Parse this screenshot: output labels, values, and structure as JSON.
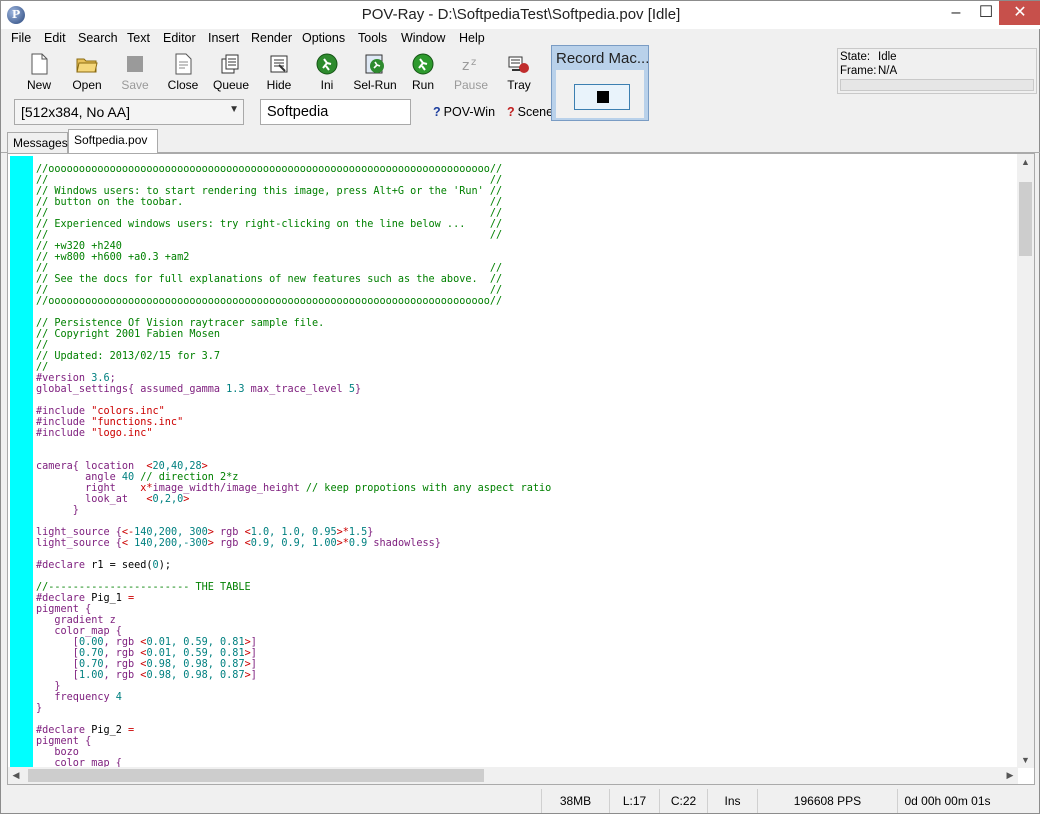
{
  "window": {
    "title": "POV-Ray - D:\\SoftpediaTest\\Softpedia.pov [Idle]",
    "controls": {
      "minimize": "–",
      "maximize": "☐",
      "close": "✕"
    }
  },
  "menu": [
    "File",
    "Edit",
    "Search",
    "Text",
    "Editor",
    "Insert",
    "Render",
    "Options",
    "Tools",
    "Window",
    "Help"
  ],
  "toolbar": [
    {
      "label": "New",
      "icon": "new-document-icon",
      "enabled": true
    },
    {
      "label": "Open",
      "icon": "open-folder-icon",
      "enabled": true
    },
    {
      "label": "Save",
      "icon": "save-icon",
      "enabled": false
    },
    {
      "label": "Close",
      "icon": "close-document-icon",
      "enabled": true
    },
    {
      "label": "Queue",
      "icon": "queue-icon",
      "enabled": true
    },
    {
      "label": "Hide",
      "icon": "hide-icon",
      "enabled": true
    },
    {
      "label": "Ini",
      "icon": "ini-runner-icon",
      "enabled": true
    },
    {
      "label": "Sel-Run",
      "icon": "sel-run-icon",
      "enabled": true
    },
    {
      "label": "Run",
      "icon": "run-icon",
      "enabled": true
    },
    {
      "label": "Pause",
      "icon": "pause-icon",
      "enabled": false
    },
    {
      "label": "Tray",
      "icon": "tray-icon",
      "enabled": true
    }
  ],
  "status_box": {
    "state_label": "State:",
    "state_value": "Idle",
    "frame_label": "Frame:",
    "frame_value": "N/A"
  },
  "resolution": {
    "selected": "[512x384, No AA]"
  },
  "scene_name": "Softpedia",
  "help_links": {
    "pov_win": "POV-Win",
    "scene": "Scene"
  },
  "tabs": [
    "Messages",
    "Softpedia.pov"
  ],
  "record_macro": {
    "title": "Record Mac..."
  },
  "editor_lines": [
    [
      [
        "cm",
        "//oooooooooooooooooooooooooooooooooooooooooooooooooooooooooooooooooooooooo//"
      ]
    ],
    [
      [
        "cm",
        "//                                                                        //"
      ]
    ],
    [
      [
        "cm",
        "// Windows users: to start rendering this image, press Alt+G or the 'Run' //"
      ]
    ],
    [
      [
        "cm",
        "// button on the toobar.                                                  //"
      ]
    ],
    [
      [
        "cm",
        "//                                                                        //"
      ]
    ],
    [
      [
        "cm",
        "// Experienced windows users: try right-clicking on the line below ...    //"
      ]
    ],
    [
      [
        "cm",
        "//                                                                        //"
      ]
    ],
    [
      [
        "cm",
        "// +w320 +h240"
      ]
    ],
    [
      [
        "cm",
        "// +w800 +h600 +a0.3 +am2"
      ]
    ],
    [
      [
        "cm",
        "//                                                                        //"
      ]
    ],
    [
      [
        "cm",
        "// See the docs for full explanations of new features such as the above.  //"
      ]
    ],
    [
      [
        "cm",
        "//                                                                        //"
      ]
    ],
    [
      [
        "cm",
        "//oooooooooooooooooooooooooooooooooooooooooooooooooooooooooooooooooooooooo//"
      ]
    ],
    [],
    [
      [
        "cm",
        "// Persistence Of Vision raytracer sample file."
      ]
    ],
    [
      [
        "cm",
        "// Copyright 2001 Fabien Mosen"
      ]
    ],
    [
      [
        "cm",
        "//"
      ]
    ],
    [
      [
        "cm",
        "// Updated: 2013/02/15 for 3.7"
      ]
    ],
    [
      [
        "cm",
        "//"
      ]
    ],
    [
      [
        "kw",
        "#version "
      ],
      [
        "nm",
        "3.6"
      ],
      [
        "kw",
        ";"
      ]
    ],
    [
      [
        "kw",
        "global_settings{ assumed_gamma "
      ],
      [
        "nm",
        "1.3"
      ],
      [
        "kw",
        " max_trace_level "
      ],
      [
        "nm",
        "5"
      ],
      [
        "kw",
        "}"
      ]
    ],
    [],
    [
      [
        "kw",
        "#include "
      ],
      [
        "st",
        "\"colors.inc\""
      ]
    ],
    [
      [
        "kw",
        "#include "
      ],
      [
        "st",
        "\"functions.inc\""
      ]
    ],
    [
      [
        "kw",
        "#include "
      ],
      [
        "st",
        "\"logo.inc\""
      ]
    ],
    [],
    [],
    [
      [
        "kw",
        "camera{ location  "
      ],
      [
        "st",
        "<"
      ],
      [
        "nm",
        "20,40,28"
      ],
      [
        "st",
        ">"
      ]
    ],
    [
      [
        "kw",
        "        angle "
      ],
      [
        "nm",
        "40"
      ],
      [
        "cm",
        " // direction 2*z"
      ]
    ],
    [
      [
        "kw",
        "        right    "
      ],
      [
        "st",
        "x*"
      ],
      [
        "kw",
        "image_width/image_height "
      ],
      [
        "cm",
        "// keep propotions with any aspect ratio"
      ]
    ],
    [
      [
        "kw",
        "        look_at   "
      ],
      [
        "st",
        "<"
      ],
      [
        "nm",
        "0,2,0"
      ],
      [
        "st",
        ">"
      ]
    ],
    [
      [
        "kw",
        "      }"
      ]
    ],
    [],
    [
      [
        "kw",
        "light_source {"
      ],
      [
        "st",
        "<-"
      ],
      [
        "nm",
        "140,200, 300"
      ],
      [
        "st",
        ">"
      ],
      [
        "kw",
        " rgb "
      ],
      [
        "st",
        "<"
      ],
      [
        "nm",
        "1.0, 1.0, 0.95"
      ],
      [
        "st",
        ">*"
      ],
      [
        "nm",
        "1.5"
      ],
      [
        "kw",
        "}"
      ]
    ],
    [
      [
        "kw",
        "light_source {"
      ],
      [
        "st",
        "< "
      ],
      [
        "nm",
        "140,200,-300"
      ],
      [
        "st",
        ">"
      ],
      [
        "kw",
        " rgb "
      ],
      [
        "st",
        "<"
      ],
      [
        "nm",
        "0.9, 0.9, 1.00"
      ],
      [
        "st",
        ">*"
      ],
      [
        "nm",
        "0.9"
      ],
      [
        "kw",
        " shadowless}"
      ]
    ],
    [],
    [
      [
        "kw",
        "#declare "
      ],
      [
        "plain",
        "r1 = seed("
      ],
      [
        "nm",
        "0"
      ],
      [
        "plain",
        ");"
      ]
    ],
    [],
    [
      [
        "cm",
        "//----------------------- THE TABLE"
      ]
    ],
    [
      [
        "kw",
        "#declare "
      ],
      [
        "plain",
        "Pig_1 "
      ],
      [
        "st",
        "="
      ]
    ],
    [
      [
        "kw",
        "pigment {"
      ]
    ],
    [
      [
        "kw",
        "   gradient z"
      ]
    ],
    [
      [
        "kw",
        "   color_map {"
      ]
    ],
    [
      [
        "kw",
        "      ["
      ],
      [
        "nm",
        "0.00"
      ],
      [
        "kw",
        ", rgb "
      ],
      [
        "st",
        "<"
      ],
      [
        "nm",
        "0.01, 0.59, 0.81"
      ],
      [
        "st",
        ">"
      ],
      [
        "kw",
        "]"
      ]
    ],
    [
      [
        "kw",
        "      ["
      ],
      [
        "nm",
        "0.70"
      ],
      [
        "kw",
        ", rgb "
      ],
      [
        "st",
        "<"
      ],
      [
        "nm",
        "0.01, 0.59, 0.81"
      ],
      [
        "st",
        ">"
      ],
      [
        "kw",
        "]"
      ]
    ],
    [
      [
        "kw",
        "      ["
      ],
      [
        "nm",
        "0.70"
      ],
      [
        "kw",
        ", rgb "
      ],
      [
        "st",
        "<"
      ],
      [
        "nm",
        "0.98, 0.98, 0.87"
      ],
      [
        "st",
        ">"
      ],
      [
        "kw",
        "]"
      ]
    ],
    [
      [
        "kw",
        "      ["
      ],
      [
        "nm",
        "1.00"
      ],
      [
        "kw",
        ", rgb "
      ],
      [
        "st",
        "<"
      ],
      [
        "nm",
        "0.98, 0.98, 0.87"
      ],
      [
        "st",
        ">"
      ],
      [
        "kw",
        "]"
      ]
    ],
    [
      [
        "kw",
        "   }"
      ]
    ],
    [
      [
        "kw",
        "   frequency "
      ],
      [
        "nm",
        "4"
      ]
    ],
    [
      [
        "kw",
        "}"
      ]
    ],
    [],
    [
      [
        "kw",
        "#declare "
      ],
      [
        "plain",
        "Pig_2 "
      ],
      [
        "st",
        "="
      ]
    ],
    [
      [
        "kw",
        "pigment {"
      ]
    ],
    [
      [
        "kw",
        "   bozo"
      ]
    ],
    [
      [
        "kw",
        "   color_map {"
      ]
    ]
  ],
  "statusbar": {
    "memory": "38MB",
    "line": "L:17",
    "col": "C:22",
    "mode": "Ins",
    "pps": "196608 PPS",
    "time": "0d 00h 00m 01s"
  }
}
